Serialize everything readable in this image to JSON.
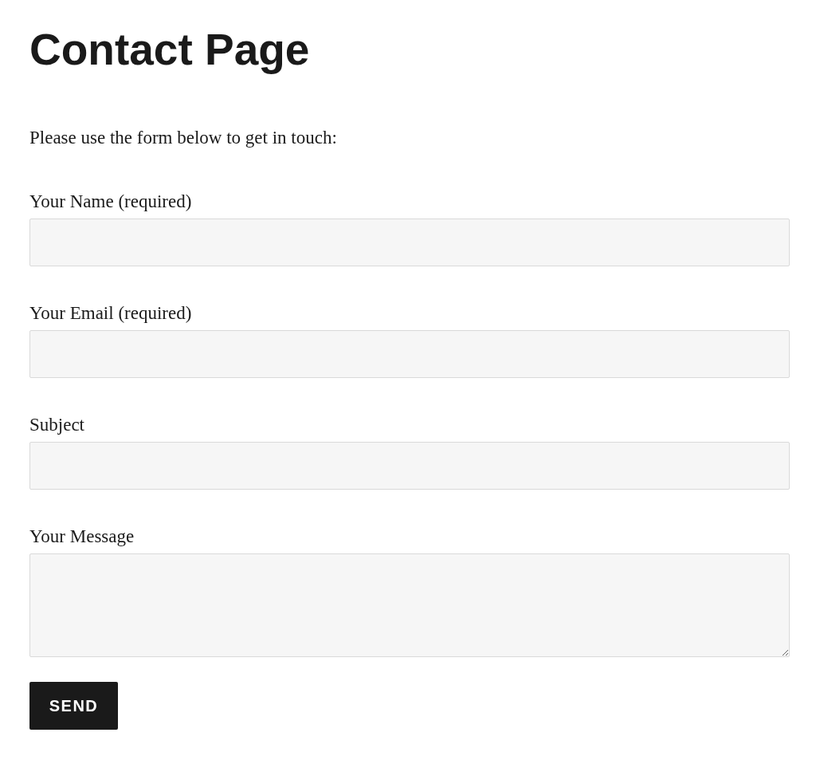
{
  "title": "Contact Page",
  "intro": "Please use the form below to get in touch:",
  "fields": [
    {
      "kind": "input",
      "label": "Your Name (required)"
    },
    {
      "kind": "input",
      "label": "Your Email (required)"
    },
    {
      "kind": "input",
      "label": "Subject"
    },
    {
      "kind": "textarea",
      "label": "Your Message"
    }
  ],
  "submit": "SEND"
}
